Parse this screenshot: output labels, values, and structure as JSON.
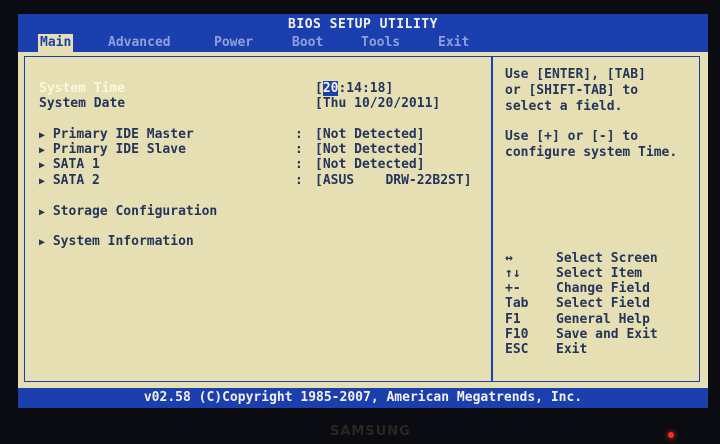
{
  "title": "BIOS SETUP UTILITY",
  "menu": [
    "Main",
    "Advanced",
    "Power",
    "Boot",
    "Tools",
    "Exit"
  ],
  "system_time": {
    "label": "System Time",
    "value_prefix": "[",
    "value_cursor": "20",
    "value_rest": ":14:18]"
  },
  "system_date": {
    "label": "System Date",
    "value": "[Thu 10/20/2011]"
  },
  "devices": [
    {
      "label": "Primary IDE Master",
      "value": "[Not Detected]"
    },
    {
      "label": "Primary IDE Slave",
      "value": "[Not Detected]"
    },
    {
      "label": "SATA 1",
      "value": "[Not Detected]"
    },
    {
      "label": "SATA 2",
      "value": "[ASUS    DRW-22B2ST]"
    }
  ],
  "submenus": [
    "Storage Configuration",
    "System Information"
  ],
  "help": {
    "line1": "Use [ENTER], [TAB]",
    "line2": "or [SHIFT-TAB] to",
    "line3": "select a field.",
    "line4": "Use [+] or [-] to",
    "line5": "configure system Time."
  },
  "keys": [
    {
      "key": "↔",
      "desc": "Select Screen"
    },
    {
      "key": "↑↓",
      "desc": "Select Item"
    },
    {
      "key": "+-",
      "desc": "Change Field"
    },
    {
      "key": "Tab",
      "desc": "Select Field"
    },
    {
      "key": "F1",
      "desc": "General Help"
    },
    {
      "key": "F10",
      "desc": "Save and Exit"
    },
    {
      "key": "ESC",
      "desc": "Exit"
    }
  ],
  "footer": "v02.58 (C)Copyright 1985-2007, American Megatrends, Inc.",
  "monitor_brand": "SAMSUNG",
  "colors": {
    "header_blue": "#1c3fb0",
    "panel_bg": "#e7dfb4",
    "text_navy": "#23355a",
    "highlight": "#fdf7dc"
  }
}
